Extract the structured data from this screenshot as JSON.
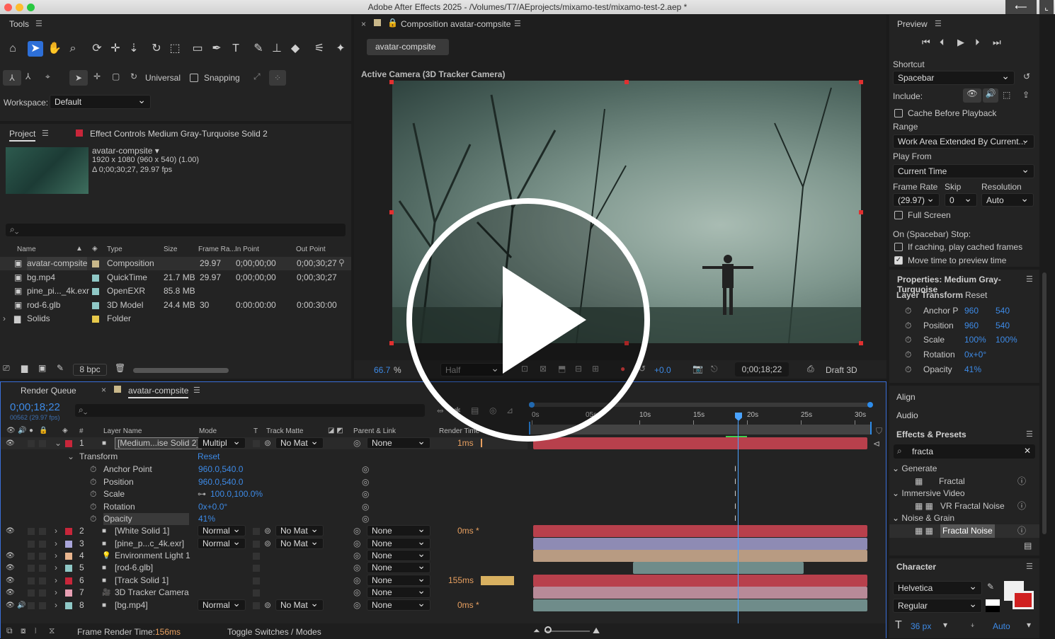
{
  "window": {
    "title": "Adobe After Effects 2025 - /Volumes/T7/AEprojects/mixamo-test/mixamo-test-2.aep *"
  },
  "tools": {
    "title": "Tools",
    "universal": "Universal",
    "snapping": "Snapping",
    "workspace_label": "Workspace:",
    "workspace_value": "Default"
  },
  "project": {
    "tab": "Project",
    "effect_tab": "Effect Controls Medium Gray-Turquoise Solid 2",
    "info_name": "avatar-compsite ▾",
    "info_dims": "1920 x 1080  (960 x 540) (1.00)",
    "info_dur": "Δ 0;00;30;27, 29.97 fps",
    "columns": [
      "Name",
      "Type",
      "Size",
      "Frame Ra...",
      "In Point",
      "Out Point"
    ],
    "items": [
      {
        "name": "avatar-compsite",
        "type": "Composition",
        "size": "",
        "fps": "29.97",
        "in": "0;00;00;00",
        "out": "0;00;30;27",
        "color": "#c9b88a"
      },
      {
        "name": "bg.mp4",
        "type": "QuickTime",
        "size": "21.7 MB",
        "fps": "29.97",
        "in": "0;00;00;00",
        "out": "0;00;30;27",
        "color": "#8fc8c6"
      },
      {
        "name": "pine_pi..._4k.exr",
        "type": "OpenEXR",
        "size": "85.8 MB",
        "fps": "",
        "in": "",
        "out": "",
        "color": "#8fc8c6"
      },
      {
        "name": "rod-6.glb",
        "type": "3D Model",
        "size": "24.4 MB",
        "fps": "30",
        "in": "0:00:00:00",
        "out": "0:00:30:00",
        "color": "#8fc8c6"
      },
      {
        "name": "Solids",
        "type": "Folder",
        "size": "",
        "fps": "",
        "in": "",
        "out": "",
        "color": "#e6c84a"
      }
    ],
    "bpc": "8 bpc"
  },
  "comp": {
    "tab_title": "Composition avatar-compsite",
    "crumb": "avatar-compsite",
    "camera": "Active Camera (3D Tracker Camera)",
    "zoom": "66.7",
    "zoom_unit": "%",
    "resolution": "Half",
    "exposure": "+0.0",
    "timecode": "0;00;18;22",
    "renderer": "Draft 3D"
  },
  "preview": {
    "title": "Preview",
    "shortcut_label": "Shortcut",
    "shortcut": "Spacebar",
    "include_label": "Include:",
    "cache": "Cache Before Playback",
    "range_label": "Range",
    "range": "Work Area Extended By Current...",
    "playfrom_label": "Play From",
    "playfrom": "Current Time",
    "fr_label": "Frame Rate",
    "skip_label": "Skip",
    "res_label": "Resolution",
    "fr": "(29.97)",
    "skip": "0",
    "res": "Auto",
    "fullscreen": "Full Screen",
    "stop_label": "On (Spacebar) Stop:",
    "if_caching": "If caching, play cached frames",
    "move_time": "Move time to preview time"
  },
  "properties": {
    "title": "Properties: Medium Gray-Turquoise",
    "layer_transform": "Layer Transform",
    "reset": "Reset",
    "rows": [
      {
        "label": "Anchor P",
        "v1": "960",
        "v2": "540"
      },
      {
        "label": "Position",
        "v1": "960",
        "v2": "540"
      },
      {
        "label": "Scale",
        "v1": "100%",
        "v2": "100%"
      },
      {
        "label": "Rotation",
        "v1": "0x+0°",
        "v2": ""
      },
      {
        "label": "Opacity",
        "v1": "41%",
        "v2": ""
      }
    ]
  },
  "side": {
    "align": "Align",
    "audio": "Audio",
    "effects": "Effects & Presets",
    "search": "fracta",
    "groups": [
      {
        "name": "Generate",
        "items": [
          "Fractal"
        ]
      },
      {
        "name": "Immersive Video",
        "items": [
          "VR Fractal Noise"
        ]
      },
      {
        "name": "Noise & Grain",
        "items": [
          "Fractal Noise"
        ]
      }
    ],
    "character": "Character",
    "font": "Helvetica",
    "style": "Regular",
    "size": "36 px",
    "leading": "Auto"
  },
  "timeline": {
    "render_tab": "Render Queue",
    "comp_tab": "avatar-compsite",
    "timecode": "0;00;18;22",
    "fps": "00562 (29.97 fps)",
    "columns": [
      "#",
      "Layer Name",
      "Mode",
      "T",
      "Track Matte",
      "Parent & Link",
      "Render Time"
    ],
    "ruler": [
      "0s",
      "05s",
      "10s",
      "15s",
      "20s",
      "25s",
      "30s"
    ],
    "transform": "Transform",
    "reset": "Reset",
    "props": [
      {
        "name": "Anchor Point",
        "value": "960.0,540.0"
      },
      {
        "name": "Position",
        "value": "960.0,540.0"
      },
      {
        "name": "Scale",
        "value": "100.0,100.0%"
      },
      {
        "name": "Rotation",
        "value": "0x+0.0°"
      },
      {
        "name": "Opacity",
        "value": "41%"
      }
    ],
    "layers": [
      {
        "num": "1",
        "name": "[Medium...ise Solid 2]",
        "mode": "Multipl",
        "matte": "No Mat",
        "parent": "None",
        "time": "1ms",
        "color": "#c8263a"
      },
      {
        "num": "2",
        "name": "[White Solid 1]",
        "mode": "Normal",
        "matte": "No Mat",
        "parent": "None",
        "time": "0ms *",
        "color": "#c8263a"
      },
      {
        "num": "3",
        "name": "[pine_p...c_4k.exr]",
        "mode": "Normal",
        "matte": "No Mat",
        "parent": "None",
        "time": "",
        "color": "#a9a5d9"
      },
      {
        "num": "4",
        "name": "Environment Light 1",
        "mode": "",
        "matte": "",
        "parent": "None",
        "time": "",
        "color": "#e9b58e"
      },
      {
        "num": "5",
        "name": "[rod-6.glb]",
        "mode": "",
        "matte": "",
        "parent": "None",
        "time": "",
        "color": "#8fc8c6"
      },
      {
        "num": "6",
        "name": "[Track Solid 1]",
        "mode": "",
        "matte": "",
        "parent": "None",
        "time": "155ms",
        "color": "#c8263a"
      },
      {
        "num": "7",
        "name": "3D Tracker Camera",
        "mode": "",
        "matte": "",
        "parent": "None",
        "time": "",
        "color": "#e8a0b4"
      },
      {
        "num": "8",
        "name": "[bg.mp4]",
        "mode": "Normal",
        "matte": "No Mat",
        "parent": "None",
        "time": "0ms *",
        "color": "#8fc8c6"
      }
    ],
    "frame_render_label": "Frame Render Time:",
    "frame_render_value": "156ms",
    "toggle": "Toggle Switches / Modes"
  },
  "colors": {
    "accent": "#2d8ceb",
    "panel": "#232323",
    "bar_red": "#c23a4a",
    "playhead": "#4aa3ff"
  }
}
